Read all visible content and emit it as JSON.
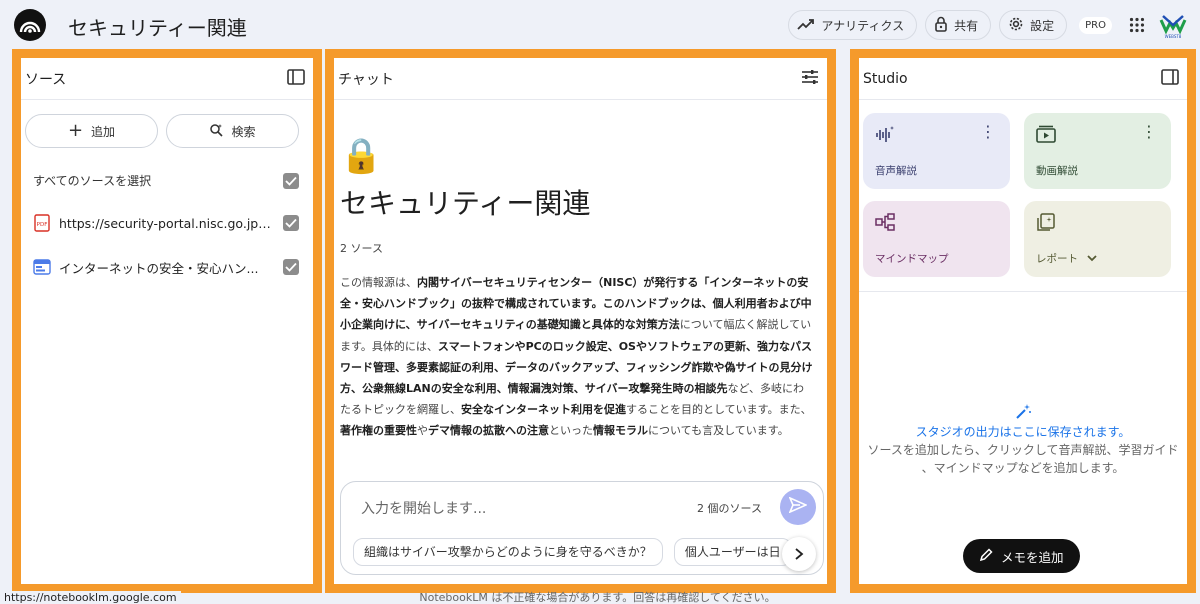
{
  "app": {
    "title": "セキュリティー関連",
    "analytics_label": "アナリティクス",
    "share_label": "共有",
    "settings_label": "設定",
    "pro_badge": "PRO",
    "corp_logo_text": "WEBST8"
  },
  "sources": {
    "header": "ソース",
    "add_label": "追加",
    "search_label": "検索",
    "select_all_label": "すべてのソースを選択",
    "items": [
      {
        "type": "pdf",
        "label": "https://security-portal.nisc.go.jp/g..."
      },
      {
        "type": "web",
        "label": "インターネットの安全・安心ハン..."
      }
    ]
  },
  "chat": {
    "header": "チャット",
    "emoji": "🔒",
    "title": "セキュリティー関連",
    "source_count": "2 ソース",
    "summary": [
      {
        "t": "この情報源は、",
        "b": false
      },
      {
        "t": "内閣サイバーセキュリティセンター（NISC）が発行する「インターネットの安全・安心ハンドブック」の抜粋で構成されています。",
        "b": true
      },
      {
        "t": "このハンドブックは、個人利用者および中小企業向けに、サイバーセキュリティの基礎知識と具体的な対策方法",
        "b": true
      },
      {
        "t": "について幅広く解説しています。具体的には、",
        "b": false
      },
      {
        "t": "スマートフォンやPCのロック設定、OSやソフトウェアの更新、強力なパスワード管理、多要素認証の利用、データのバックアップ、フィッシング詐欺や偽サイトの見分け方、公衆無線LANの安全な利用、情報漏洩対策、サイバー攻撃発生時の相談先",
        "b": true
      },
      {
        "t": "など、多岐にわたるトピックを網羅し、",
        "b": false
      },
      {
        "t": "安全なインターネット利用を促進",
        "b": true
      },
      {
        "t": "することを目的としています。また、",
        "b": false
      },
      {
        "t": "著作権の重要性",
        "b": true
      },
      {
        "t": "や",
        "b": false
      },
      {
        "t": "デマ情報の拡散への注意",
        "b": true
      },
      {
        "t": "といった",
        "b": false
      },
      {
        "t": "情報モラル",
        "b": true
      },
      {
        "t": "についても言及しています。",
        "b": false
      }
    ],
    "input_placeholder": "入力を開始します...",
    "input_source_count": "2 個のソース",
    "suggestions": [
      "組織はサイバー攻撃からどのように身を守るべきか？",
      "個人ユーザーは日"
    ]
  },
  "studio": {
    "header": "Studio",
    "tiles": {
      "audio": "音声解説",
      "video": "動画解説",
      "mindmap": "マインドマップ",
      "report": "レポート"
    },
    "empty_title": "スタジオの出力はここに保存されます。",
    "empty_line1": "ソースを追加したら、クリックして音声解説、学習ガイド",
    "empty_line2": "、マインドマップなどを追加します。",
    "add_note_label": "メモを追加"
  },
  "footer": {
    "status_url": "https://notebooklm.google.com",
    "note": "NotebookLM は不正確な場合があります。回答は再確認してください。"
  },
  "colors": {
    "accent_border": "#f59a2b",
    "send_button": "#aab3f2",
    "link_blue": "#1a73e8"
  }
}
